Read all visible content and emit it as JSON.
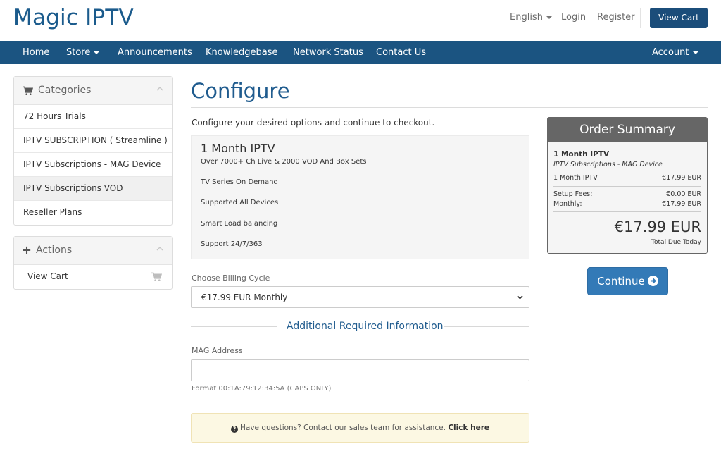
{
  "header": {
    "logo": "Magic IPTV",
    "language": "English",
    "login": "Login",
    "register": "Register",
    "view_cart": "View Cart"
  },
  "nav": {
    "home": "Home",
    "store": "Store",
    "announcements": "Announcements",
    "knowledgebase": "Knowledgebase",
    "network_status": "Network Status",
    "contact_us": "Contact Us",
    "account": "Account"
  },
  "sidebar": {
    "categories_title": "Categories",
    "categories": [
      {
        "label": "72 Hours Trials"
      },
      {
        "label": "IPTV SUBSCRIPTION ( Streamline )"
      },
      {
        "label": "IPTV Subscriptions - MAG Device"
      },
      {
        "label": "IPTV Subscriptions VOD"
      },
      {
        "label": "Reseller Plans"
      }
    ],
    "actions_title": "Actions",
    "actions": [
      {
        "label": "View Cart"
      }
    ]
  },
  "main": {
    "title": "Configure",
    "intro": "Configure your desired options and continue to checkout.",
    "product": {
      "name": "1 Month IPTV",
      "features": [
        "Over 7000+ Ch Live & 2000 VOD And Box Sets",
        "TV Series On Demand",
        "Supported All Devices",
        "Smart Load balancing",
        "Support 24/7/363"
      ]
    },
    "billing_label": "Choose Billing Cycle",
    "billing_value": "€17.99 EUR Monthly",
    "additional_heading": "Additional Required Information",
    "mag_label": "MAG Address",
    "mag_value": "",
    "mag_help": "Format 00:1A:79:12:34:5A (CAPS ONLY)",
    "alert_text": "Have questions? Contact our sales team for assistance.",
    "alert_link": "Click here"
  },
  "summary": {
    "title": "Order Summary",
    "product_name": "1 Month IPTV",
    "product_group": "IPTV Subscriptions - MAG Device",
    "line_label": "1 Month IPTV",
    "line_price": "€17.99 EUR",
    "setup_label": "Setup Fees:",
    "setup_value": "€0.00 EUR",
    "monthly_label": "Monthly:",
    "monthly_value": "€17.99 EUR",
    "total": "€17.99 EUR",
    "total_label": "Total Due Today",
    "continue": "Continue"
  },
  "colors": {
    "brand": "#1b5b8c",
    "navbar": "#1b5481",
    "primary_button": "#337ab7",
    "summary_header": "#666666"
  },
  "icons": {
    "categories": "shopping-cart-icon",
    "actions": "plus-icon",
    "view_cart": "shopping-cart-icon",
    "alert": "question-circle-icon",
    "continue": "arrow-circle-right-icon"
  }
}
